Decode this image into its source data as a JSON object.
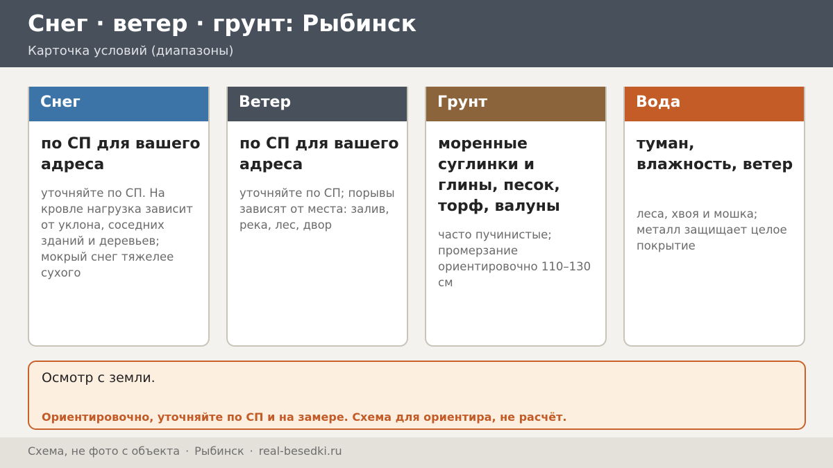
{
  "header": {
    "title": "Снег · ветер · грунт: Рыбинск",
    "subtitle": "Карточка условий (диапазоны)",
    "bg_color": "#48505c"
  },
  "cards": [
    {
      "title": "Снег",
      "value": "по СП для вашего адреса",
      "note": "уточняйте по СП. На кровле нагрузка зависит от уклона, соседних зданий и деревьев; мокрый снег тяжелее сухого",
      "color": "#3d74a8"
    },
    {
      "title": "Ветер",
      "value": "по СП для вашего адреса",
      "note": "уточняйте по СП; порывы зависят от места: залив, река, лес, двор",
      "color": "#48505c"
    },
    {
      "title": "Грунт",
      "value": "моренные суглинки и глины, песок, торф, валуны",
      "note": "часто пучинистые; промерзание ориентировочно 110–130 см",
      "color": "#8b643c"
    },
    {
      "title": "Вода",
      "value": "туман, влажность, ветер",
      "note": "леса, хвоя и мошка; металл защищает целое покрытие",
      "color": "#c45c27"
    }
  ],
  "notice": {
    "text": "Осмотр с земли.",
    "warning": "Ориентировочно, уточняйте по СП и на замере. Схема для ориентира, не расчёт.",
    "accent_color": "#c8622a"
  },
  "footer": {
    "source": "Схема, не фото с объекта",
    "city": "Рыбинск",
    "site": "real-besedki.ru",
    "separator": "·"
  }
}
